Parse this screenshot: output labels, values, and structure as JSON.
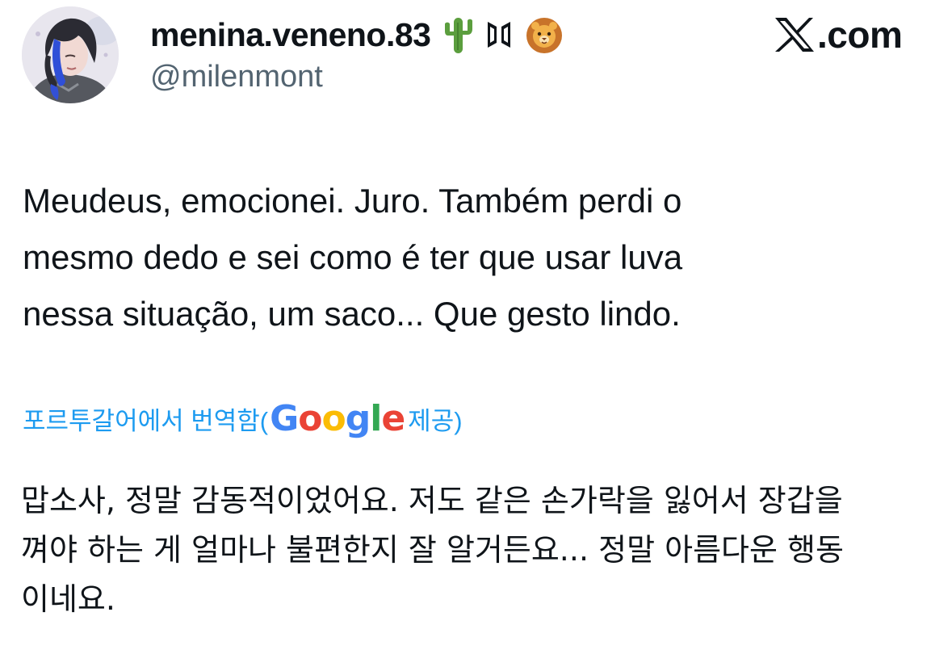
{
  "author": {
    "display_name": "menina.veneno.83",
    "name_emojis": [
      "cactus-emoji",
      "bts-logo-icon",
      "lion-emoji"
    ],
    "handle": "@milenmont",
    "avatar": "avatar-illustration"
  },
  "brand": {
    "icon": "x-logo-icon",
    "text": ".com"
  },
  "tweet": {
    "lines": [
      "Meudeus, emocionei.  Juro. Também perdi o",
      "mesmo dedo e sei como é ter que usar luva",
      "nessa situação, um saco... Que gesto lindo."
    ]
  },
  "translation_label": {
    "prefix": "포르투갈어에서 번역함(",
    "provider": "Google",
    "suffix": " 제공)"
  },
  "translation": {
    "lines": [
      "맙소사, 정말 감동적이었어요. 저도 같은 손가락을 잃어서 장갑을",
      "껴야 하는 게 얼마나 불편한지 잘 알거든요... 정말 아름다운 행동",
      "이네요."
    ]
  },
  "colors": {
    "link": "#1d9bf0",
    "secondary_text": "#536471",
    "primary_text": "#0f1419"
  }
}
